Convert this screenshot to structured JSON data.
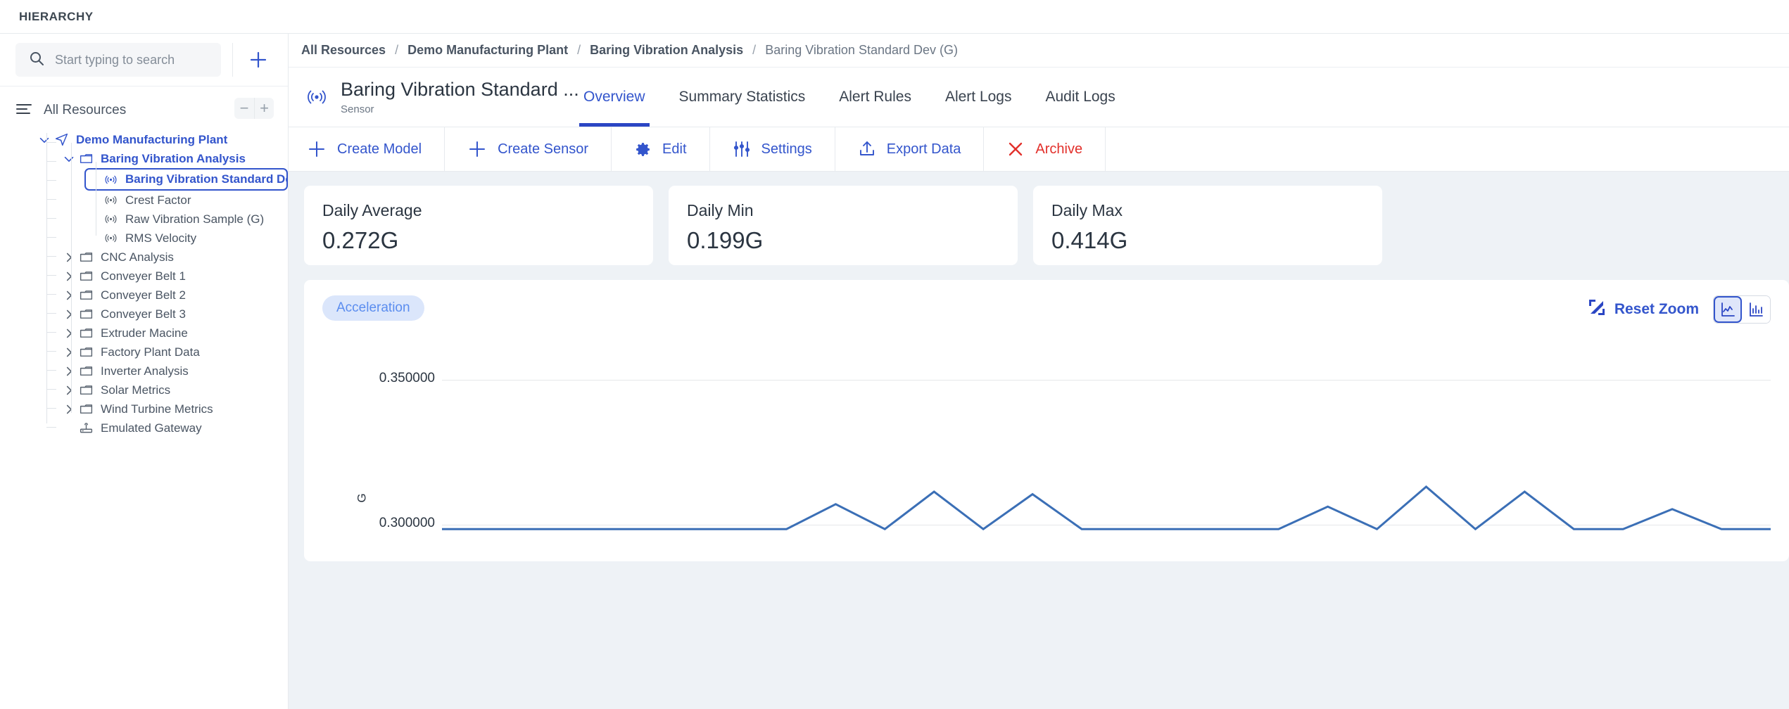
{
  "topbar": {
    "title": "HIERARCHY"
  },
  "sidebar": {
    "search": {
      "placeholder": "Start typing to search",
      "value": ""
    },
    "add_button_icon": "plus-icon",
    "tree_header": {
      "label": "All Resources",
      "zoom_out": "−",
      "zoom_in": "+"
    },
    "tree": [
      {
        "label": "Demo Manufacturing Plant",
        "icon": "navigation-arrow-icon",
        "depth": 1,
        "caret": "down",
        "style": "blue"
      },
      {
        "label": "Baring Vibration Analysis",
        "icon": "folder-icon",
        "depth": 2,
        "caret": "down",
        "style": "blue"
      },
      {
        "label": "Baring Vibration Standard De...",
        "icon": "sensor-icon",
        "depth": 3,
        "caret": "none",
        "style": "selected"
      },
      {
        "label": "Crest Factor",
        "icon": "sensor-icon",
        "depth": 3,
        "caret": "none",
        "style": "plain"
      },
      {
        "label": "Raw Vibration Sample (G)",
        "icon": "sensor-icon",
        "depth": 3,
        "caret": "none",
        "style": "plain"
      },
      {
        "label": "RMS Velocity",
        "icon": "sensor-icon",
        "depth": 3,
        "caret": "none",
        "style": "plain"
      },
      {
        "label": "CNC Analysis",
        "icon": "folder-icon",
        "depth": 2,
        "caret": "right",
        "style": "plain"
      },
      {
        "label": "Conveyer Belt 1",
        "icon": "folder-icon",
        "depth": 2,
        "caret": "right",
        "style": "plain"
      },
      {
        "label": "Conveyer Belt 2",
        "icon": "folder-icon",
        "depth": 2,
        "caret": "right",
        "style": "plain"
      },
      {
        "label": "Conveyer Belt 3",
        "icon": "folder-icon",
        "depth": 2,
        "caret": "right",
        "style": "plain"
      },
      {
        "label": "Extruder Macine",
        "icon": "folder-icon",
        "depth": 2,
        "caret": "right",
        "style": "plain"
      },
      {
        "label": "Factory Plant Data",
        "icon": "folder-icon",
        "depth": 2,
        "caret": "right",
        "style": "plain"
      },
      {
        "label": "Inverter Analysis",
        "icon": "folder-icon",
        "depth": 2,
        "caret": "right",
        "style": "plain"
      },
      {
        "label": "Solar Metrics",
        "icon": "folder-icon",
        "depth": 2,
        "caret": "right",
        "style": "plain"
      },
      {
        "label": "Wind Turbine Metrics",
        "icon": "folder-icon",
        "depth": 2,
        "caret": "right",
        "style": "plain"
      },
      {
        "label": "Emulated Gateway",
        "icon": "gateway-icon",
        "depth": 2,
        "caret": "none",
        "style": "plain"
      }
    ]
  },
  "breadcrumb": [
    {
      "label": "All Resources",
      "current": false
    },
    {
      "label": "Demo Manufacturing Plant",
      "current": false
    },
    {
      "label": "Baring Vibration Analysis",
      "current": false
    },
    {
      "label": "Baring Vibration Standard Dev (G)",
      "current": true
    }
  ],
  "breadcrumb_separator": "/",
  "header": {
    "icon": "sensor-icon",
    "title": "Baring Vibration Standard ...",
    "subtitle": "Sensor"
  },
  "tabs": [
    {
      "label": "Overview",
      "active": true
    },
    {
      "label": "Summary Statistics",
      "active": false
    },
    {
      "label": "Alert Rules",
      "active": false
    },
    {
      "label": "Alert Logs",
      "active": false
    },
    {
      "label": "Audit Logs",
      "active": false
    }
  ],
  "toolbar": [
    {
      "label": "Create Model",
      "icon": "plus-icon",
      "danger": false
    },
    {
      "label": "Create Sensor",
      "icon": "plus-icon",
      "danger": false
    },
    {
      "label": "Edit",
      "icon": "gear-icon",
      "danger": false
    },
    {
      "label": "Settings",
      "icon": "sliders-icon",
      "danger": false
    },
    {
      "label": "Export Data",
      "icon": "upload-icon",
      "danger": false
    },
    {
      "label": "Archive",
      "icon": "close-x-icon",
      "danger": true
    }
  ],
  "kpis": [
    {
      "label": "Daily Average",
      "value": "0.272G"
    },
    {
      "label": "Daily Min",
      "value": "0.199G"
    },
    {
      "label": "Daily Max",
      "value": "0.414G"
    }
  ],
  "chart_panel": {
    "chip": "Acceleration",
    "reset_zoom": "Reset Zoom",
    "reset_zoom_icon": "expand-arrows-icon",
    "view_modes": [
      {
        "icon": "line-chart-icon",
        "active": true
      },
      {
        "icon": "bar-chart-icon",
        "active": false
      }
    ]
  },
  "chart_data": {
    "type": "line",
    "title": "",
    "xlabel": "",
    "ylabel": "G",
    "ylim": [
      0.2875,
      0.3625
    ],
    "yticks": [
      0.35,
      0.3
    ],
    "ytick_labels": [
      "0.350000",
      "0.300000"
    ],
    "grid": true,
    "legend": [
      "Acceleration"
    ],
    "series": [
      {
        "name": "Acceleration",
        "color": "#3b6fb6",
        "x": [
          0,
          1,
          2,
          3,
          4,
          5,
          6,
          7,
          8,
          9,
          10,
          11,
          12,
          13,
          14,
          15,
          16,
          17,
          18,
          19,
          20,
          21,
          22,
          23,
          24,
          25,
          26,
          27
        ],
        "values": [
          0.288,
          0.288,
          0.288,
          0.288,
          0.288,
          0.288,
          0.288,
          0.288,
          0.298,
          0.288,
          0.303,
          0.288,
          0.302,
          0.288,
          0.288,
          0.288,
          0.288,
          0.288,
          0.297,
          0.288,
          0.305,
          0.288,
          0.303,
          0.288,
          0.288,
          0.296,
          0.288,
          0.288
        ]
      }
    ]
  }
}
